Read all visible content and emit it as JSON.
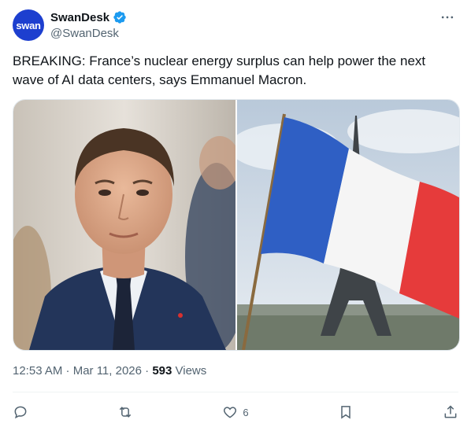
{
  "author": {
    "avatar_text": "swan",
    "display_name": "SwanDesk",
    "handle": "@SwanDesk",
    "verified_icon": "verified-badge-icon",
    "brand_color": "#1d3fcf"
  },
  "tweet": {
    "text": "BREAKING: France’s nuclear energy surplus can help power the next wave of AI data centers, says Emmanuel Macron.",
    "time": "12:53 AM · Mar 11, 2026 · ",
    "views_count": "593",
    "views_label": " Views"
  },
  "actions": {
    "reply_icon": "reply-icon",
    "retweet_icon": "retweet-icon",
    "like_icon": "heart-icon",
    "like_count": "6",
    "bookmark_icon": "bookmark-icon",
    "share_icon": "share-icon"
  },
  "colors": {
    "text": "#0f1419",
    "secondary": "#536471",
    "verified": "#1d9bf0",
    "flag_blue": "#2f5fc4",
    "flag_red": "#e63b3b"
  }
}
